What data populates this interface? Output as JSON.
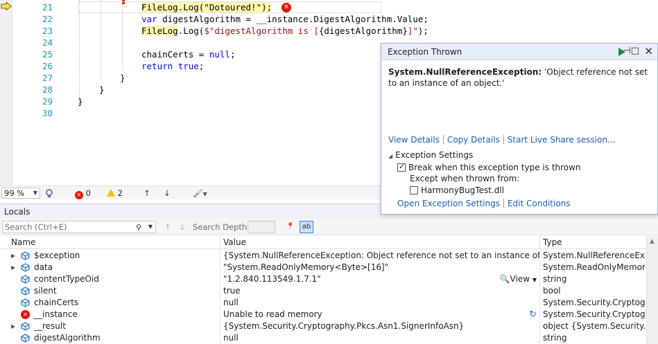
{
  "editor": {
    "lines": [
      {
        "num": "21",
        "code": "FileLog.Log(\"Dotoured!\");"
      },
      {
        "num": "22",
        "code": "var digestAlgorithm = __instance.DigestAlgorithm.Value;"
      },
      {
        "num": "23",
        "code": "FileLog.Log($\"digestAlgorithm is [{digestAlgorithm}]\");"
      },
      {
        "num": "24",
        "code": ""
      },
      {
        "num": "25",
        "code": "chainCerts = null;"
      },
      {
        "num": "26",
        "code": "return true;"
      },
      {
        "num": "27",
        "code": "}"
      },
      {
        "num": "28",
        "code": "}"
      },
      {
        "num": "29",
        "code": "}"
      },
      {
        "num": "30",
        "code": ""
      }
    ],
    "error_glyph": "✕"
  },
  "status_bar": {
    "zoom": "99 %",
    "errors": "0",
    "warnings": "2"
  },
  "locals": {
    "title": "Locals",
    "search_placeholder": "Search (Ctrl+E)",
    "search_depth_label": "Search Depth:",
    "columns": {
      "name": "Name",
      "value": "Value",
      "type": "Type"
    },
    "rows": [
      {
        "name": "$exception",
        "value": "{System.NullReferenceException: Object reference not set to an instance of an object...",
        "type": "System.NullReferenceExce..."
      },
      {
        "name": "data",
        "value": "\"System.ReadOnlyMemory<Byte>[16]\"",
        "type": "System.ReadOnlyMemory..."
      },
      {
        "name": "contentTypeOid",
        "value": "\"1.2.840.113549.1.7.1\"",
        "type": "string",
        "view": "View"
      },
      {
        "name": "silent",
        "value": "true",
        "type": "bool"
      },
      {
        "name": "chainCerts",
        "value": "null",
        "type": "System.Security.Cryptogra..."
      },
      {
        "name": "__instance",
        "value": "Unable to read memory",
        "type": "System.Security.Cryptogra..."
      },
      {
        "name": "__result",
        "value": "{System.Security.Cryptography.Pkcs.Asn1.SignerInfoAsn}",
        "type": "object {System.Security.Cr..."
      },
      {
        "name": "digestAlgorithm",
        "value": "null",
        "type": "string"
      }
    ]
  },
  "exception": {
    "title": "Exception Thrown",
    "exception_type": "System.NullReferenceException:",
    "message": " 'Object reference not set to an instance of an object.'",
    "links": [
      "View Details",
      "Copy Details",
      "Start Live Share session..."
    ],
    "settings_label": "Exception Settings",
    "break_label": "Break when this exception type is thrown",
    "except_label": "Except when thrown from:",
    "module_label": "HarmonyBugTest.dll",
    "bottom_links": [
      "Open Exception Settings",
      "Edit Conditions"
    ]
  },
  "colors": {
    "accent": "#1a5fb4",
    "error": "#e51400",
    "keyword": "#0000ff",
    "string": "#a31515",
    "line_number": "#2b91af"
  }
}
